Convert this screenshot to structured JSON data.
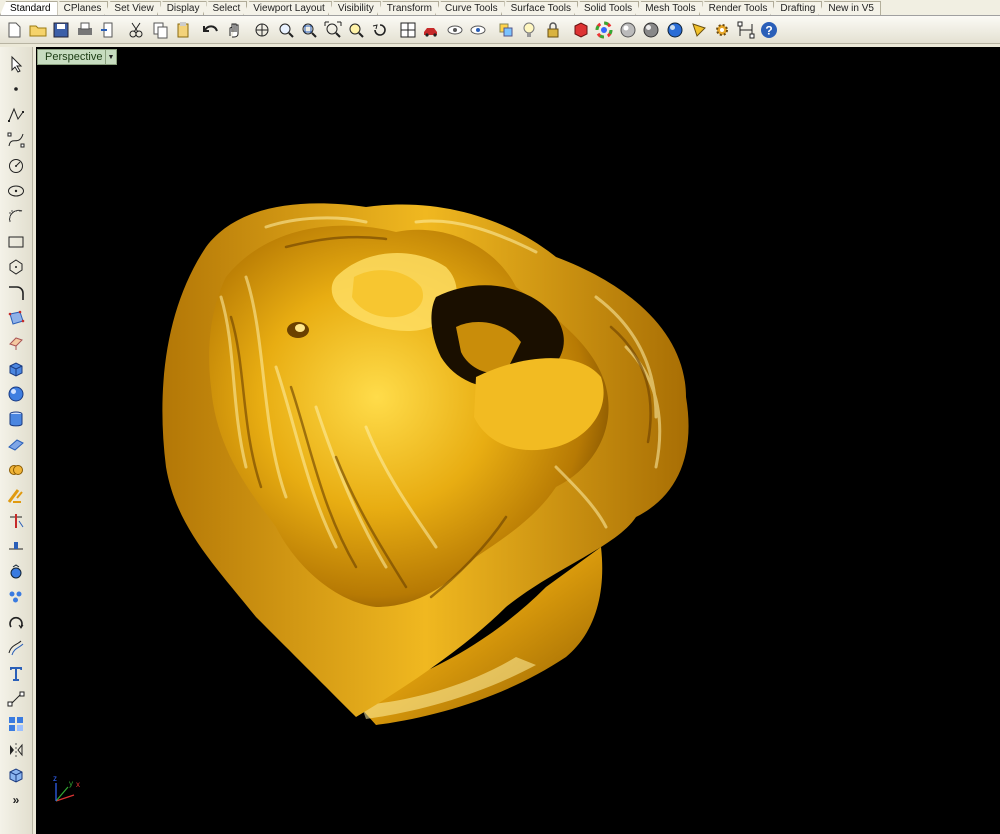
{
  "tabs": [
    {
      "label": "Standard",
      "active": true
    },
    {
      "label": "CPlanes"
    },
    {
      "label": "Set View"
    },
    {
      "label": "Display"
    },
    {
      "label": "Select"
    },
    {
      "label": "Viewport Layout"
    },
    {
      "label": "Visibility"
    },
    {
      "label": "Transform"
    },
    {
      "label": "Curve Tools"
    },
    {
      "label": "Surface Tools"
    },
    {
      "label": "Solid Tools"
    },
    {
      "label": "Mesh Tools"
    },
    {
      "label": "Render Tools"
    },
    {
      "label": "Drafting"
    },
    {
      "label": "New in V5"
    }
  ],
  "toolbar_icons": [
    "new-file-icon",
    "open-folder-icon",
    "save-icon",
    "print-icon",
    "import-icon",
    "cut-icon",
    "copy-icon",
    "paste-icon",
    "undo-icon",
    "pan-hand-icon",
    "rotate-view-icon",
    "zoom-dynamic-icon",
    "zoom-window-icon",
    "zoom-extents-icon",
    "zoom-selected-icon",
    "undo-view-icon",
    "four-viewports-icon",
    "car-object-icon",
    "hide-objects-icon",
    "show-objects-icon",
    "layer-icon",
    "light-bulb-icon",
    "lock-icon",
    "material-icon",
    "color-wheel-icon",
    "shaded-sphere-icon",
    "rendered-sphere-icon",
    "blue-sphere-icon",
    "render-cone-icon",
    "options-gear-icon",
    "dimension-icon",
    "help-icon"
  ],
  "left_tools": [
    "select-arrow-icon",
    "point-icon",
    "polyline-icon",
    "curve-icon",
    "circle-icon",
    "ellipse-icon",
    "arc-icon",
    "rectangle-icon",
    "polygon-icon",
    "curve-fillet-icon",
    "surface-from-points-icon",
    "extrude-icon",
    "box-solid-icon",
    "sphere-solid-icon",
    "cylinder-icon",
    "plane-surface-icon",
    "boolean-union-icon",
    "gumball-icon",
    "trim-icon",
    "split-icon",
    "group-icon",
    "array-icon",
    "rotate-icon",
    "offset-icon",
    "text-icon",
    "dimension-tool-icon",
    "transform-block-icon",
    "mirror-icon",
    "cube-view-icon",
    "more-tools-icon"
  ],
  "viewport": {
    "label": "Perspective"
  },
  "axis_labels": {
    "x": "x",
    "y": "y",
    "z": "z"
  },
  "colors": {
    "viewport_bg": "#000000",
    "viewport_label_bg": "#c7dcc0",
    "object_gold": "#e0a50a",
    "object_highlight": "#ffd84a",
    "object_shadow": "#7a4d00"
  }
}
